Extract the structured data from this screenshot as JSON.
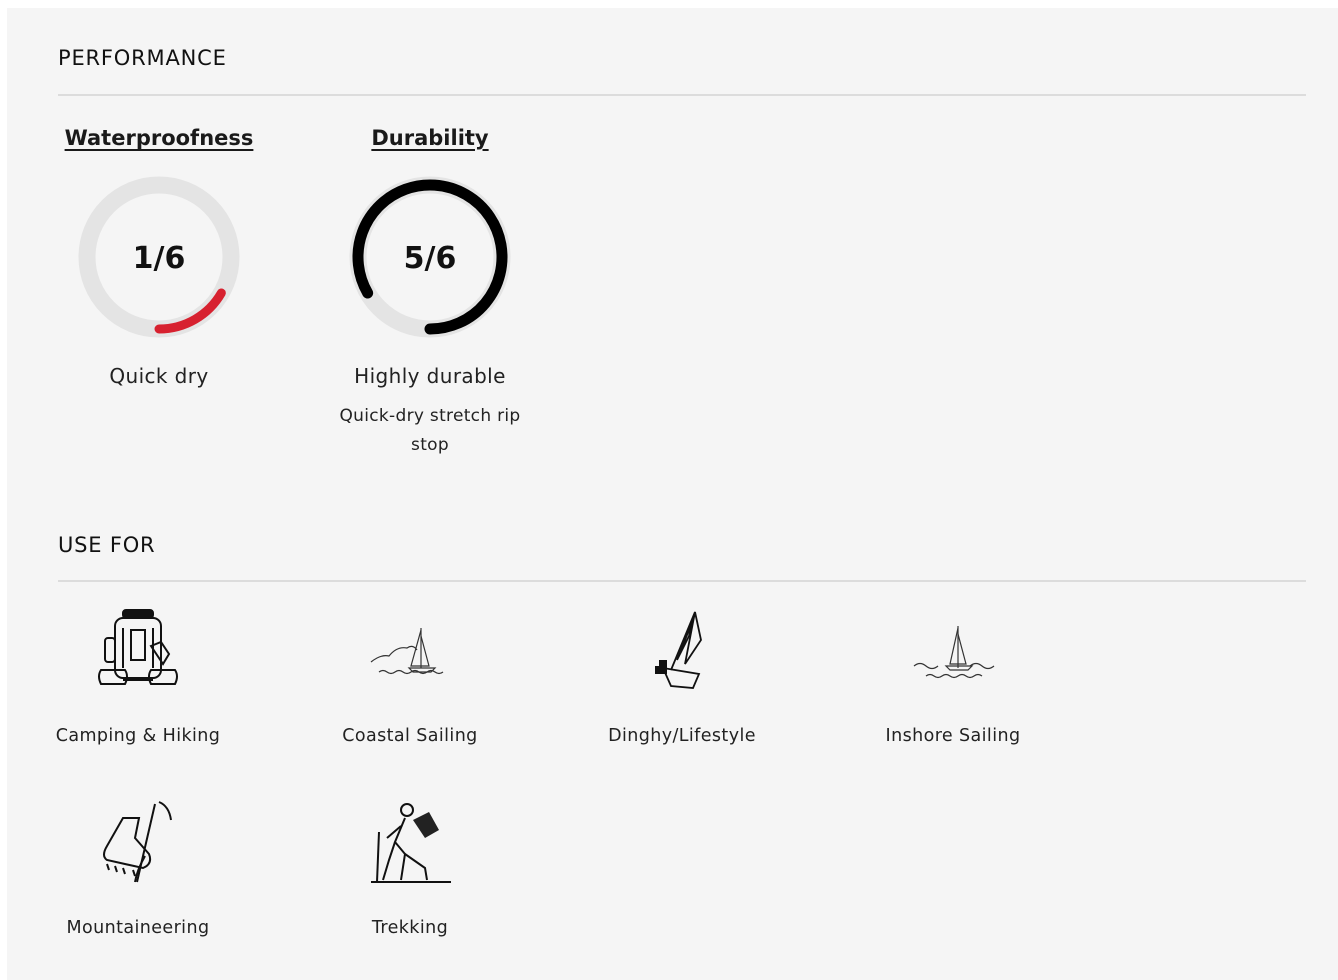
{
  "performance": {
    "title": "PERFORMANCE",
    "items": [
      {
        "name": "Waterproofness",
        "rating": 1,
        "max": 6,
        "rating_text": "1/6",
        "description": "Quick dry",
        "subtitle": "",
        "color": "#d7212f"
      },
      {
        "name": "Durability",
        "rating": 5,
        "max": 6,
        "rating_text": "5/6",
        "description": "Highly durable",
        "subtitle": "Quick-dry stretch rip stop",
        "color": "#000000"
      }
    ]
  },
  "use_for": {
    "title": "USE FOR",
    "items": [
      {
        "label": "Camping & Hiking",
        "icon": "backpack-icon"
      },
      {
        "label": "Coastal Sailing",
        "icon": "coastal-sailboat-icon"
      },
      {
        "label": "Dinghy/Lifestyle",
        "icon": "dinghy-icon"
      },
      {
        "label": "Inshore Sailing",
        "icon": "inshore-sailboat-icon"
      },
      {
        "label": "Mountaineering",
        "icon": "boot-ice-axe-icon"
      },
      {
        "label": "Trekking",
        "icon": "trekker-icon"
      }
    ]
  },
  "colors": {
    "panel_bg": "#f5f5f5",
    "track": "#e4e4e4",
    "low_rating": "#d7212f",
    "high_rating": "#000000"
  }
}
